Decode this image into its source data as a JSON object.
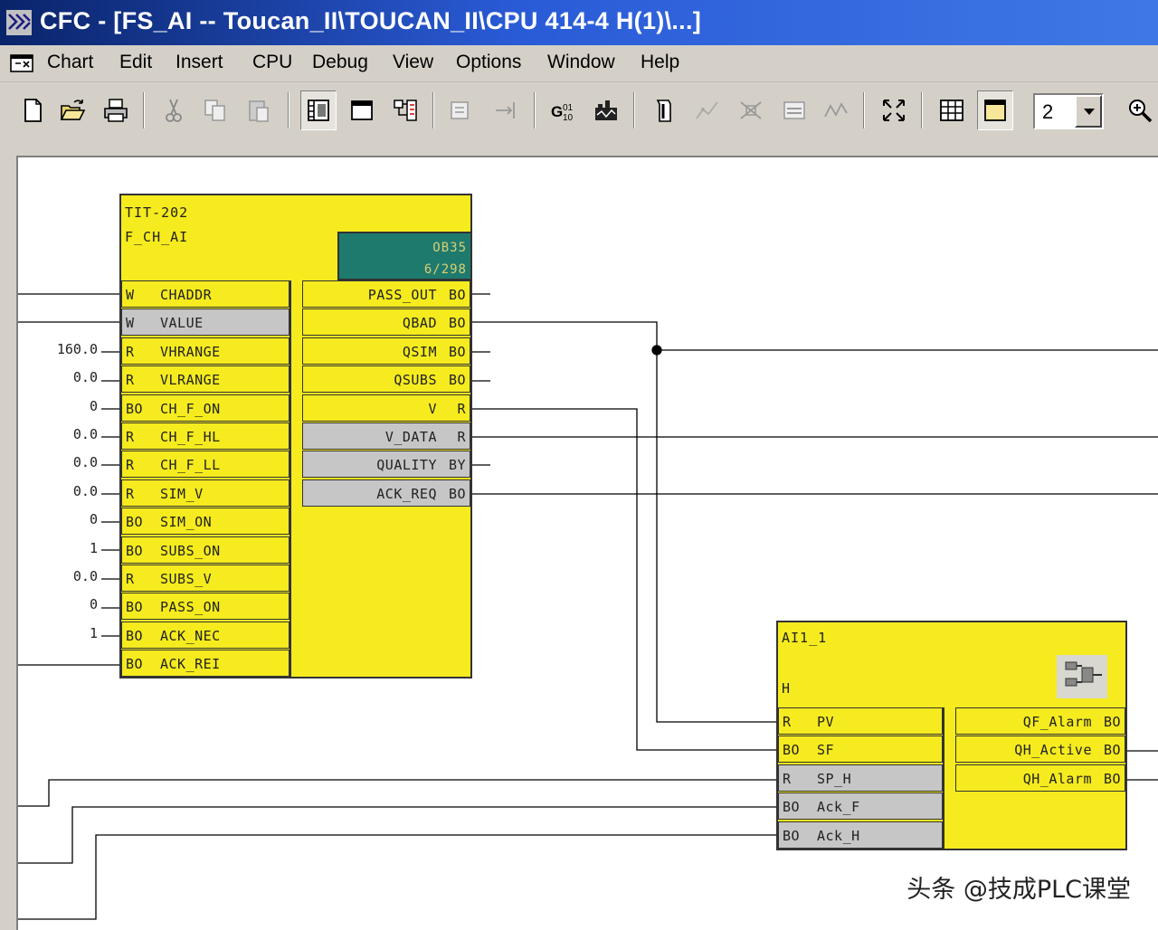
{
  "window": {
    "title": "CFC - [FS_AI -- Toucan_II\\TOUCAN_II\\CPU 414-4 H(1)\\...]"
  },
  "menu": [
    "Chart",
    "Edit",
    "Insert",
    "CPU",
    "Debug",
    "View",
    "Options",
    "Window",
    "Help"
  ],
  "toolbar": {
    "zoom_value": "2",
    "icons": [
      "new-icon",
      "open-icon",
      "print-icon",
      "cut-icon",
      "copy-icon",
      "paste-icon",
      "catalog-icon",
      "window-icon",
      "block-icon",
      "compile-icon",
      "connect-icon",
      "goto-icon",
      "download-icon",
      "test-mode-icon",
      "monitor-icon",
      "watch-icon",
      "trend-icon",
      "fit-icon",
      "sheet-view-icon",
      "overview-icon",
      "zoom-in-icon"
    ]
  },
  "block_tit": {
    "name": "TIT-202",
    "type": "F_CH_AI",
    "task_line1": "OB35",
    "task_line2": "6/298",
    "inputs": [
      {
        "type": "W",
        "name": "CHADDR",
        "value": "",
        "grey": false
      },
      {
        "type": "W",
        "name": "VALUE",
        "value": "",
        "grey": true
      },
      {
        "type": "R",
        "name": "VHRANGE",
        "value": "160.0",
        "grey": false
      },
      {
        "type": "R",
        "name": "VLRANGE",
        "value": "0.0",
        "grey": false
      },
      {
        "type": "BO",
        "name": "CH_F_ON",
        "value": "0",
        "grey": false
      },
      {
        "type": "R",
        "name": "CH_F_HL",
        "value": "0.0",
        "grey": false
      },
      {
        "type": "R",
        "name": "CH_F_LL",
        "value": "0.0",
        "grey": false
      },
      {
        "type": "R",
        "name": "SIM_V",
        "value": "0.0",
        "grey": false
      },
      {
        "type": "BO",
        "name": "SIM_ON",
        "value": "0",
        "grey": false
      },
      {
        "type": "BO",
        "name": "SUBS_ON",
        "value": "1",
        "grey": false
      },
      {
        "type": "R",
        "name": "SUBS_V",
        "value": "0.0",
        "grey": false
      },
      {
        "type": "BO",
        "name": "PASS_ON",
        "value": "0",
        "grey": false
      },
      {
        "type": "BO",
        "name": "ACK_NEC",
        "value": "1",
        "grey": false
      },
      {
        "type": "BO",
        "name": "ACK_REI",
        "value": "",
        "grey": false
      }
    ],
    "outputs": [
      {
        "name": "PASS_OUT",
        "type": "BO",
        "grey": false
      },
      {
        "name": "QBAD",
        "type": "BO",
        "grey": false
      },
      {
        "name": "QSIM",
        "type": "BO",
        "grey": false
      },
      {
        "name": "QSUBS",
        "type": "BO",
        "grey": false
      },
      {
        "name": "V",
        "type": "R",
        "grey": false
      },
      {
        "name": "V_DATA",
        "type": "R",
        "grey": true
      },
      {
        "name": "QUALITY",
        "type": "BY",
        "grey": true
      },
      {
        "name": "ACK_REQ",
        "type": "BO",
        "grey": true
      }
    ]
  },
  "block_ai": {
    "name": "AI1_1",
    "type": "H",
    "inputs": [
      {
        "type": "R",
        "name": "PV",
        "grey": false
      },
      {
        "type": "BO",
        "name": "SF",
        "grey": false
      },
      {
        "type": "R",
        "name": "SP_H",
        "grey": true
      },
      {
        "type": "BO",
        "name": "Ack_F",
        "grey": true
      },
      {
        "type": "BO",
        "name": "Ack_H",
        "grey": true
      }
    ],
    "outputs": [
      {
        "name": "QF_Alarm",
        "type": "BO"
      },
      {
        "name": "QH_Active",
        "type": "BO"
      },
      {
        "name": "QH_Alarm",
        "type": "BO"
      }
    ]
  },
  "watermark": "头条 @技成PLC课堂",
  "colors": {
    "block": "#f5eb1e",
    "task_box": "#1f7a6e",
    "title_bar": "#0a246a"
  }
}
